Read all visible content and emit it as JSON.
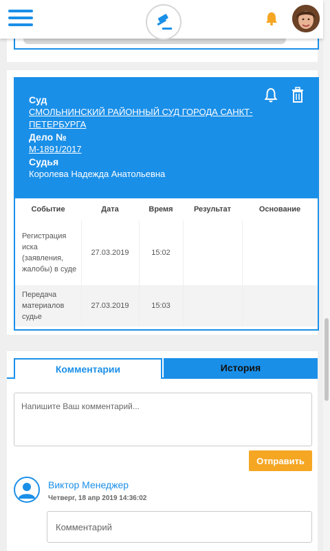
{
  "header": {
    "menu_icon": "hamburger-icon",
    "logo_icon": "gavel-icon",
    "notification_icon": "bell-icon",
    "colors": {
      "accent": "#1a8fe8",
      "bell": "#f5a623"
    }
  },
  "court_card": {
    "court_label": "Суд",
    "court_name": "СМОЛЬНИНСКИЙ РАЙОННЫЙ СУД ГОРОДА САНКТ-ПЕТЕРБУРГА",
    "case_label": "Дело №",
    "case_number": "М-1891/2017",
    "judge_label": "Судья",
    "judge_name": "Королева Надежда Анатольевна",
    "subscribe_icon": "bell-outline-icon",
    "delete_icon": "trash-icon",
    "table": {
      "headers": [
        "Событие",
        "Дата",
        "Время",
        "Результат",
        "Основание"
      ],
      "rows": [
        [
          "Регистрация иска (заявления, жалобы) в суде",
          "27.03.2019",
          "15:02",
          "",
          ""
        ],
        [
          "Передача материалов судье",
          "27.03.2019",
          "15:03",
          "",
          ""
        ]
      ]
    }
  },
  "comments": {
    "tabs": [
      {
        "label": "Комментарии",
        "active": true
      },
      {
        "label": "История",
        "active": false
      }
    ],
    "input_placeholder": "Напишите Ваш комментарий...",
    "send_label": "Отправить",
    "entries": [
      {
        "author": "Виктор Менеджер",
        "date": "Четверг, 18 апр 2019 14:36:02",
        "reply_placeholder": "Комментарий"
      }
    ]
  }
}
